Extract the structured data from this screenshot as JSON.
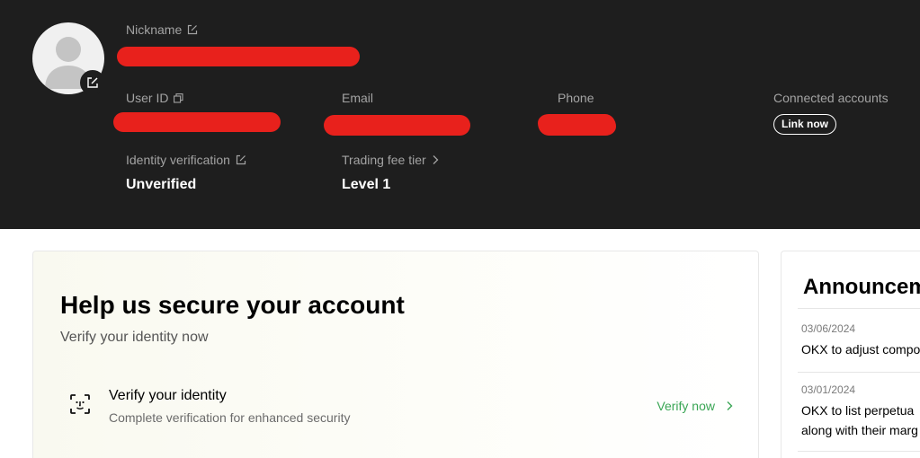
{
  "profile": {
    "nickname_label": "Nickname",
    "user_id_label": "User ID",
    "email_label": "Email",
    "phone_label": "Phone",
    "connected_accounts_label": "Connected accounts",
    "link_now_label": "Link now",
    "identity_label": "Identity verification",
    "identity_value": "Unverified",
    "fee_tier_label": "Trading fee tier",
    "fee_tier_value": "Level 1"
  },
  "security": {
    "title": "Help us secure your account",
    "subtitle": "Verify your identity now",
    "verify_title": "Verify your identity",
    "verify_desc": "Complete verification for enhanced security",
    "verify_action": "Verify now"
  },
  "announcements": {
    "title": "Announcem",
    "items": [
      {
        "date": "03/06/2024",
        "lines": [
          "OKX to adjust compo"
        ]
      },
      {
        "date": "03/01/2024",
        "lines": [
          "OKX to list perpetua",
          "along with their marg"
        ]
      }
    ]
  },
  "colors": {
    "header_bg": "#1e1e1e",
    "redaction": "#e8211c",
    "accent_green": "#3aa655"
  },
  "icons": {
    "avatar": "default-user-avatar",
    "edit": "edit-icon",
    "copy": "copy-icon",
    "chevron": "chevron-right-icon",
    "face_scan": "face-scan-icon"
  }
}
